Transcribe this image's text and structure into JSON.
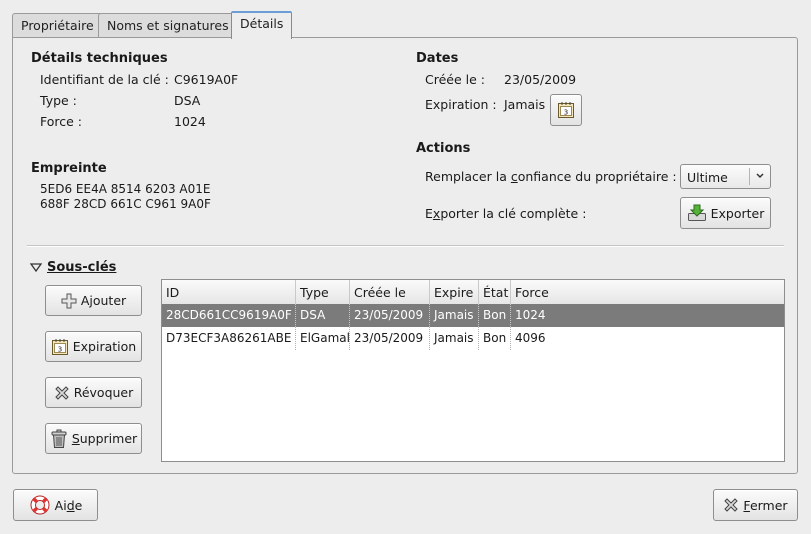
{
  "tabs": [
    {
      "label": "Propriétaire"
    },
    {
      "label": "Noms et signatures"
    },
    {
      "label": "Détails"
    }
  ],
  "tech": {
    "title": "Détails techniques",
    "key_id_label": "Identifiant de la clé :",
    "key_id_value": "C9619A0F",
    "type_label": "Type :",
    "type_value": "DSA",
    "strength_label": "Force :",
    "strength_value": "1024"
  },
  "fingerprint": {
    "title": "Empreinte",
    "line1": "5ED6 EE4A 8514 6203 A01E",
    "line2": "688F 28CD 661C C961 9A0F"
  },
  "dates": {
    "title": "Dates",
    "created_label": "Créée le :",
    "created_value": "23/05/2009",
    "expiration_label": "Expiration :",
    "expiration_value": "Jamais"
  },
  "actions": {
    "title": "Actions",
    "trust_label_pre": "Remplacer la ",
    "trust_label_mn": "c",
    "trust_label_post": "onfiance du propriétaire :",
    "trust_value": "Ultime",
    "export_label_pre": "E",
    "export_label_mn": "x",
    "export_label_post": "porter la clé complète :",
    "export_button": "Exporter"
  },
  "subkeys": {
    "title": "Sous-clés",
    "buttons": {
      "add": "Ajouter",
      "expiration": "Expiration",
      "revoke": "Révoquer",
      "delete_mn": "S",
      "delete_rest": "upprimer"
    },
    "columns": [
      "ID",
      "Type",
      "Créée le",
      "Expire",
      "État",
      "Force"
    ],
    "rows": [
      {
        "id": "28CD661CC9619A0F",
        "type": "DSA",
        "created": "23/05/2009",
        "expires": "Jamais",
        "state": "Bon",
        "strength": "1024"
      },
      {
        "id": "D73ECF3A86261ABE",
        "type": "ElGamal",
        "created": "23/05/2009",
        "expires": "Jamais",
        "state": "Bon",
        "strength": "4096"
      }
    ]
  },
  "footer": {
    "help_pre": "Ai",
    "help_mn": "d",
    "help_post": "e",
    "close_mn": "F",
    "close_rest": "ermer"
  },
  "icons": {
    "calendar": "calendar-icon",
    "export": "export-icon",
    "add": "plus-icon",
    "revoke": "x-icon",
    "delete": "trash-icon",
    "help": "lifebuoy-icon",
    "close": "close-icon"
  }
}
